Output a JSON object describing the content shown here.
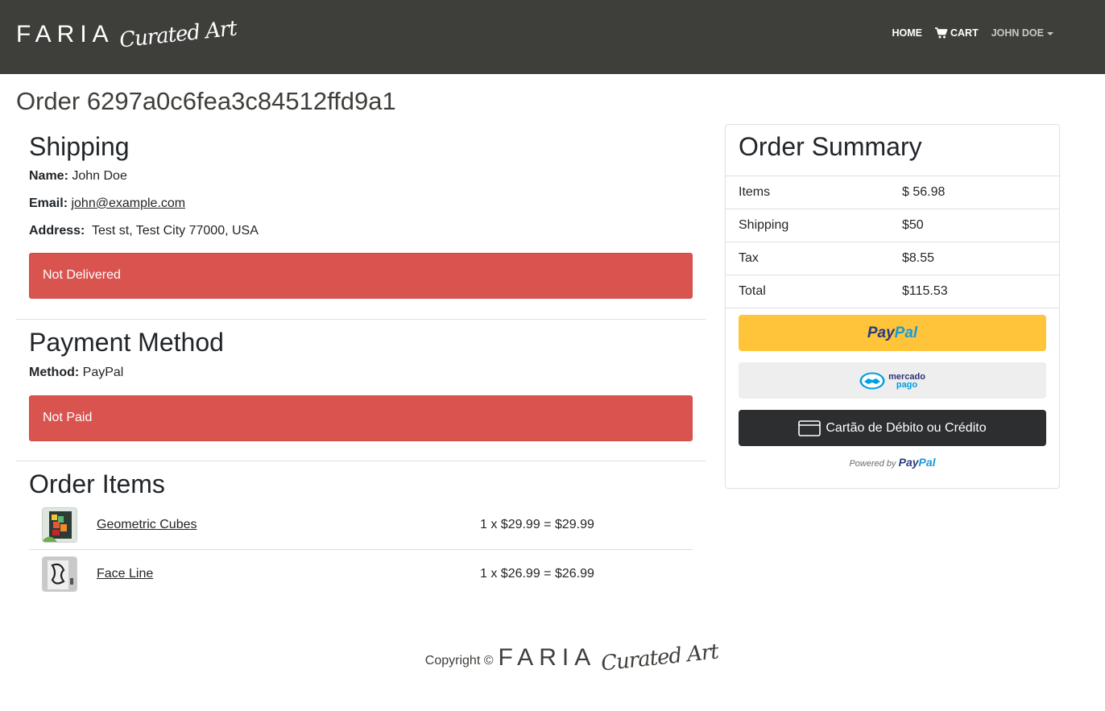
{
  "brand": {
    "word": "FARIA",
    "script": "Curated Art"
  },
  "nav": {
    "home": "HOME",
    "cart": "CART",
    "user": "JOHN DOE"
  },
  "order": {
    "title": "Order 6297a0c6fea3c84512ffd9a1"
  },
  "shipping": {
    "heading": "Shipping",
    "name_label": "Name:",
    "name": "John Doe",
    "email_label": "Email:",
    "email": "john@example.com",
    "address_label": "Address:",
    "address": "Test st, Test City 77000, USA",
    "status": "Not Delivered"
  },
  "payment": {
    "heading": "Payment Method",
    "method_label": "Method:",
    "method": "PayPal",
    "status": "Not Paid"
  },
  "items": {
    "heading": "Order Items",
    "list": [
      {
        "name": "Geometric Cubes",
        "price": "1 x $29.99 = $29.99"
      },
      {
        "name": "Face Line",
        "price": "1 x $26.99 = $26.99"
      }
    ]
  },
  "summary": {
    "heading": "Order Summary",
    "rows": [
      {
        "label": "Items",
        "value": "$ 56.98"
      },
      {
        "label": "Shipping",
        "value": "$50"
      },
      {
        "label": "Tax",
        "value": "$8.55"
      },
      {
        "label": "Total",
        "value": "$115.53"
      }
    ],
    "paypal_pay": "Pay",
    "paypal_pal": "Pal",
    "mercado_line1": "mercado",
    "mercado_line2": "pago",
    "card_button": "Cartão de Débito ou Crédito",
    "powered_by": "Powered by"
  },
  "footer": {
    "copyright": "Copyright ©"
  },
  "colors": {
    "navbar": "#3e3f3a",
    "danger": "#d9534f",
    "paypal_yellow": "#ffc439",
    "card_dark": "#2c2e2f"
  }
}
